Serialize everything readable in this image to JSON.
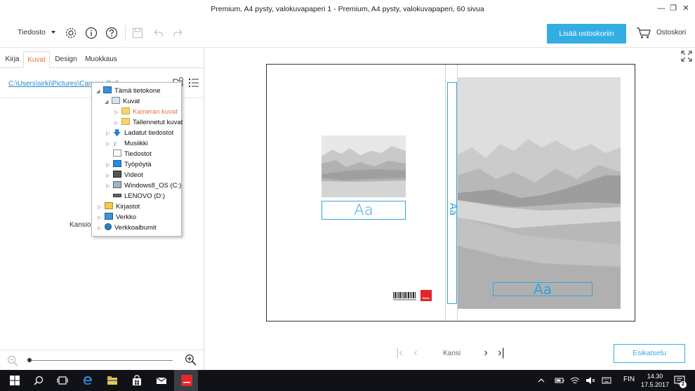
{
  "window": {
    "title": "Premium, A4 pysty, valokuvapaperi 1 - Premium, A4 pysty, valokuvapaperi, 60 sivua",
    "controls": {
      "minimize": "—",
      "restore": "❐",
      "close": "✕"
    }
  },
  "toolbar": {
    "file_menu": "Tiedosto",
    "icons": [
      "settings-icon",
      "info-icon",
      "help-icon",
      "save-icon",
      "undo-icon",
      "redo-icon"
    ],
    "add_to_cart": "Lisää ostoskoriin",
    "cart_label": "Ostoskori"
  },
  "left_panel": {
    "tabs": [
      {
        "label": "Kirja",
        "active": false
      },
      {
        "label": "Kuvat",
        "active": true
      },
      {
        "label": "Design",
        "active": false
      },
      {
        "label": "Muokkaus",
        "active": false
      }
    ],
    "path": "C:\\Users\\sirki\\Pictures\\Camera Roll",
    "folder_text": "Kansios",
    "zoom_level": 0
  },
  "tree": {
    "items": [
      {
        "label": "Tämä tietokone",
        "expanded": true,
        "icon": "computer-icon"
      },
      {
        "label": "Kuvat",
        "expanded": true,
        "icon": "pictures-icon"
      },
      {
        "label": "Kameran kuvat",
        "selected": true,
        "icon": "folder-icon"
      },
      {
        "label": "Tallennetut kuvat",
        "icon": "folder-icon"
      },
      {
        "label": "Ladatut tiedostot",
        "icon": "download-icon"
      },
      {
        "label": "Musiikki",
        "icon": "music-icon"
      },
      {
        "label": "Tiedostot",
        "icon": "document-icon"
      },
      {
        "label": "Työpöytä",
        "icon": "desktop-icon"
      },
      {
        "label": "Videot",
        "icon": "video-icon"
      },
      {
        "label": "Windows8_OS (C:)",
        "icon": "drive-icon"
      },
      {
        "label": "LENOVO (D:)",
        "icon": "drive-icon"
      },
      {
        "label": "Kirjastot",
        "icon": "library-icon"
      },
      {
        "label": "Verkko",
        "icon": "network-icon"
      },
      {
        "label": "Verkkoalbumit",
        "icon": "globe-icon"
      }
    ]
  },
  "canvas": {
    "spine_text": "Aa",
    "back_text": "Aa",
    "front_text": "Aa",
    "logo_text": "Ifolor."
  },
  "navigation": {
    "page_label": "Kansi",
    "first": "|‹",
    "prev": "‹",
    "next": "›",
    "last": "›|"
  },
  "preview_button": "Esikatselu",
  "taskbar": {
    "language": "FIN",
    "time": "14.30",
    "date": "17.5.2017"
  },
  "colors": {
    "accent": "#33aee3",
    "active_tab": "#e8743b",
    "taskbar": "#101218",
    "brand_red": "#e0282b"
  }
}
